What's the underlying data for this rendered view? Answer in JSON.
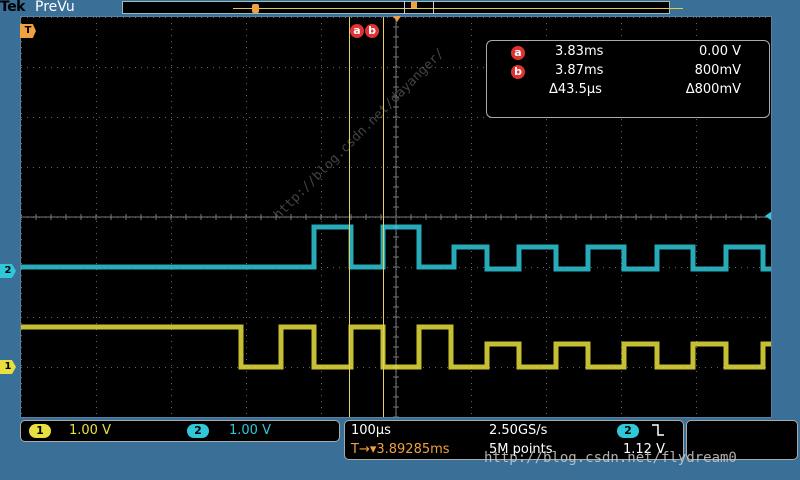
{
  "brand": "Tek",
  "mode": "PreVu",
  "colors": {
    "ch1": "#e8e040",
    "ch2": "#30c8d8",
    "trigger": "#f0a040",
    "cursor": "#e8d060",
    "grid": "#555555"
  },
  "trigger_marker": "T",
  "channel_markers": {
    "ch1": "1",
    "ch2": "2"
  },
  "cursors": {
    "a": {
      "tag": "a",
      "time": "3.83ms",
      "value": "0.00 V"
    },
    "b": {
      "tag": "b",
      "time": "3.87ms",
      "value": "800mV"
    },
    "delta": {
      "time": "Δ43.5μs",
      "value": "Δ800mV"
    }
  },
  "bottom": {
    "ch1": {
      "badge": "1",
      "scale": "1.00 V"
    },
    "ch2": {
      "badge": "2",
      "scale": "1.00 V"
    },
    "timebase": "100μs",
    "sample_rate": "2.50GS/s",
    "trigger_pos": "T→▾3.89285ms",
    "record_length": "5M points",
    "trigger_source": {
      "badge": "2",
      "slope_icon": "falling-edge-icon",
      "level": "1.12 V"
    }
  },
  "watermark": "http://blog.csdn.net/flydream0",
  "diagonal_watermark": "http://blog.csdn.net/dayanger/"
}
